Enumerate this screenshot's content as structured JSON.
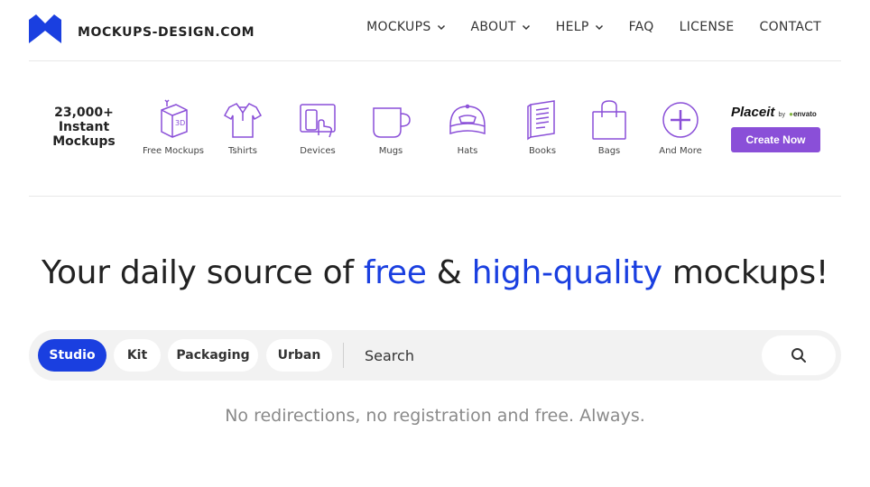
{
  "header": {
    "logo_text": "MOCKUPS-DESIGN.COM",
    "nav": [
      {
        "label": "MOCKUPS",
        "dropdown": true
      },
      {
        "label": "ABOUT",
        "dropdown": true
      },
      {
        "label": "HELP",
        "dropdown": true
      },
      {
        "label": "FAQ",
        "dropdown": false
      },
      {
        "label": "LICENSE",
        "dropdown": false
      },
      {
        "label": "CONTACT",
        "dropdown": false
      }
    ]
  },
  "categories": {
    "count_line1": "23,000+",
    "count_line2": "Instant",
    "count_line3": "Mockups",
    "items": [
      {
        "label": "Free Mockups",
        "icon": "3d-box-icon"
      },
      {
        "label": "Tshirts",
        "icon": "tshirt-icon"
      },
      {
        "label": "Devices",
        "icon": "devices-icon"
      },
      {
        "label": "Mugs",
        "icon": "mug-icon"
      },
      {
        "label": "Hats",
        "icon": "hat-icon"
      },
      {
        "label": "Books",
        "icon": "book-icon"
      },
      {
        "label": "Bags",
        "icon": "bag-icon"
      },
      {
        "label": "And More",
        "icon": "plus-circle-icon"
      }
    ],
    "placeit": {
      "brand": "Placeit",
      "by": "by",
      "partner": "envato",
      "cta": "Create Now"
    }
  },
  "hero": {
    "part1": "Your daily source of ",
    "highlight1": "free",
    "part2": " & ",
    "highlight2": "high-quality",
    "part3": " mockups!"
  },
  "search": {
    "filters": [
      {
        "label": "Studio",
        "active": true
      },
      {
        "label": "Kit",
        "active": false
      },
      {
        "label": "Packaging",
        "active": false
      },
      {
        "label": "Urban",
        "active": false
      }
    ],
    "placeholder": "Search"
  },
  "tagline": "No redirections, no registration and free. Always.",
  "colors": {
    "accent_blue": "#1a3fe0",
    "icon_purple": "#8a4fd8",
    "placeit_button": "#8a4fd8"
  }
}
